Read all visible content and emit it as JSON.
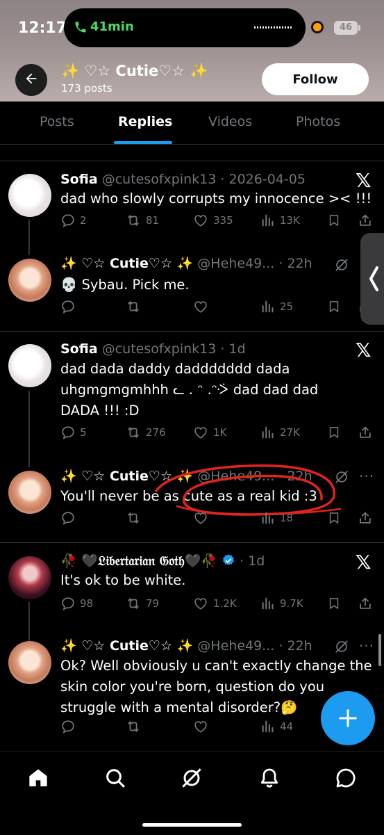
{
  "status_bar": {
    "time": "12:17",
    "call_duration": "41min",
    "battery": "46"
  },
  "header": {
    "name": "✨ ♡☆ Cutie♡☆ ✨",
    "post_count": "173 posts",
    "follow_label": "Follow"
  },
  "tabs": [
    "Posts",
    "Replies",
    "Videos",
    "Photos"
  ],
  "active_tab": "Replies",
  "posts": [
    {
      "name": "Sofia",
      "handle": "@cutesofxpink13",
      "sep": "·",
      "date": "2026-04-05",
      "text": "dad who slowly corrupts my innocence >< !!!",
      "replies": "2",
      "reposts": "81",
      "likes": "335",
      "views": "13K"
    },
    {
      "name": "✨ ♡☆ Cutie♡☆ ✨",
      "handle": "@Hehe49...",
      "sep": "·",
      "date": "22h",
      "text": "💀 Sybau. Pick me.",
      "views": "25"
    },
    {
      "name": "Sofia",
      "handle": "@cutesofxpink13",
      "sep": "·",
      "date": "1d",
      "text": "dad dada daddy daddddddd dada uhgmgmgmhhh ᓚ . ᵔ .ᵔᢶ dad dad dad DADA !!! :D",
      "replies": "5",
      "reposts": "276",
      "likes": "1K",
      "views": "27K"
    },
    {
      "name": "✨ ♡☆ Cutie♡☆ ✨",
      "handle": "@Hehe49...",
      "sep": "·",
      "date": "22h",
      "text": "You'll never be as cute as a real kid :3",
      "views": "18"
    },
    {
      "name": "🥀 🖤𝔏𝔦𝔟𝔢𝔯𝔱𝔞𝔯𝔦𝔞𝔫 𝔊𝔬𝔱𝔥🖤🥀",
      "sep": "·",
      "date": "1d",
      "text": "It's ok to be white.",
      "replies": "98",
      "reposts": "79",
      "likes": "1.2K",
      "views": "9.7K"
    },
    {
      "name": "✨ ♡☆ Cutie♡☆ ✨",
      "handle": "@Hehe49...",
      "sep": "·",
      "date": "22h",
      "text": "Ok? Well obviously u can't exactly change the skin color you're born, question do you struggle with a mental disorder?🤔",
      "views": "44"
    }
  ],
  "colors": {
    "accent": "#1d9bf0",
    "muted": "#71767b",
    "verified": "#1d9bf0",
    "annotation": "#e0251b",
    "call": "#4cd964"
  },
  "icons": [
    "phone-icon",
    "back-arrow-icon",
    "x-logo-icon",
    "grok-icon",
    "more-icon",
    "reply-icon",
    "repost-icon",
    "like-icon",
    "views-icon",
    "bookmark-icon",
    "share-icon",
    "verified-icon",
    "compose-icon",
    "home-icon",
    "search-icon",
    "notifications-icon",
    "messages-icon"
  ]
}
